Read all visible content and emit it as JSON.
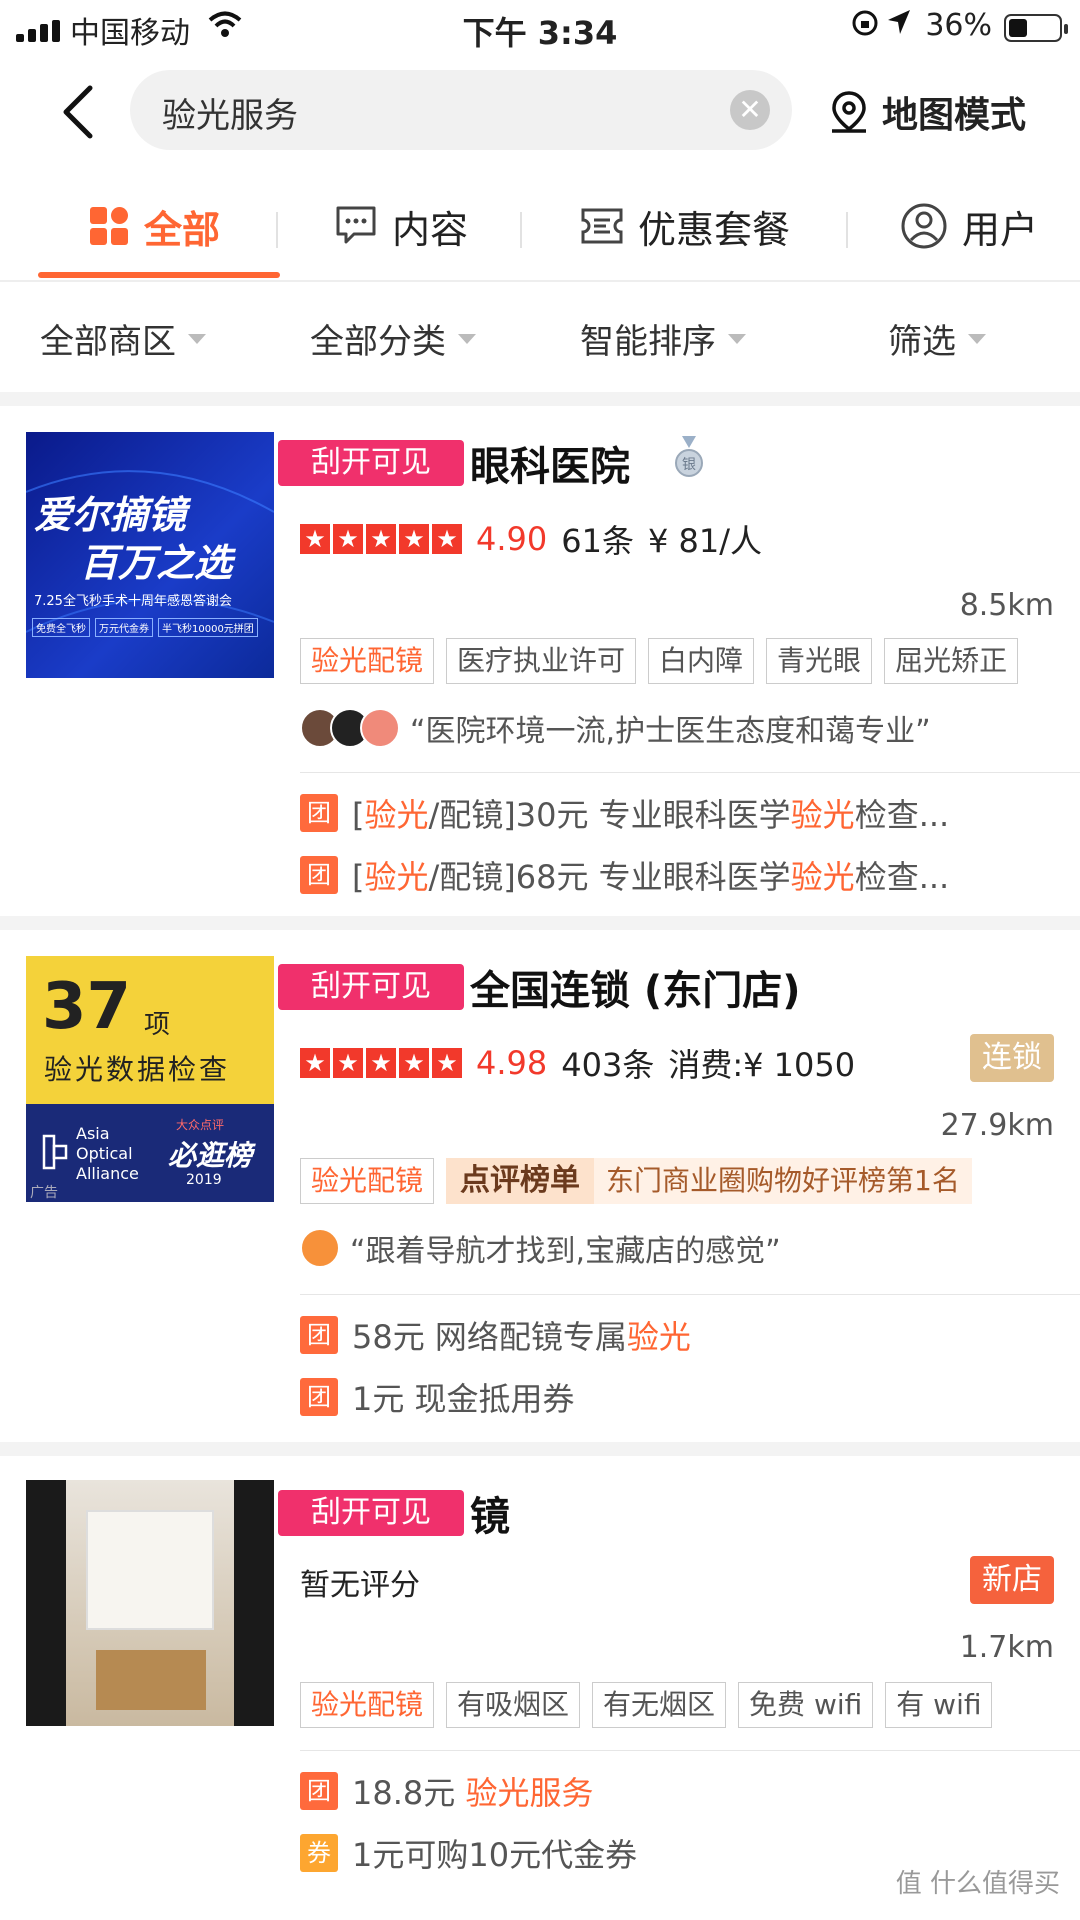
{
  "status_bar": {
    "carrier": "中国移动",
    "time": "下午 3:34",
    "battery": "36%"
  },
  "search": {
    "query": "验光服务",
    "map_mode": "地图模式"
  },
  "tabs": [
    {
      "label": "全部",
      "icon": "grid-icon"
    },
    {
      "label": "内容",
      "icon": "chat-icon"
    },
    {
      "label": "优惠套餐",
      "icon": "ticket-icon"
    },
    {
      "label": "用户",
      "icon": "user-icon"
    }
  ],
  "filters": [
    "全部商区",
    "全部分类",
    "智能排序",
    "筛选"
  ],
  "listings": [
    {
      "badge": "刮开可见",
      "name": "眼科医院",
      "medal": "银",
      "score": "4.90",
      "reviews": "61条",
      "price": "¥ 81/人",
      "distance": "8.5km",
      "thumb": {
        "line1": "爱尔摘镜",
        "line2": "百万之选",
        "line3": "7.25全飞秒手术十周年感恩答谢会",
        "chips": [
          "免费全飞秒",
          "万元代金券",
          "半飞秒10000元拼团"
        ]
      },
      "tags": [
        "验光配镜",
        "医疗执业许可",
        "白内障",
        "青光眼",
        "屈光矫正"
      ],
      "review": "“医院环境一流,护士医生态度和蔼专业”",
      "deals": [
        {
          "icon": "团",
          "pre": "[",
          "hl1": "验光",
          "mid": "/配镜]30元 专业眼科医学",
          "hl2": "验光",
          "post": "检查..."
        },
        {
          "icon": "团",
          "pre": "[",
          "hl1": "验光",
          "mid": "/配镜]68元 专业眼科医学",
          "hl2": "验光",
          "post": "检查..."
        }
      ]
    },
    {
      "badge": "刮开可见",
      "name": "全国连锁 (东门店)",
      "score": "4.98",
      "reviews": "403条",
      "price": "消费:¥ 1050",
      "pill": "连锁",
      "distance": "27.9km",
      "thumb": {
        "num": "37",
        "unit": "项",
        "title": "验光数据检查",
        "brand1": "Asia",
        "brand2": "Optical",
        "brand3": "Alliance",
        "award_top": "大众点评",
        "award": "必逛榜",
        "year": "2019",
        "ad": "广告"
      },
      "tags": [
        "验光配镜"
      ],
      "rank_left": "点评榜单",
      "rank_right": "东门商业圈购物好评榜第1名",
      "review": "“跟着导航才找到,宝藏店的感觉”",
      "deals": [
        {
          "icon": "团",
          "pre": "58元 网络配镜专属",
          "hl1": "验光"
        },
        {
          "icon": "团",
          "pre": "1元 现金抵用券"
        }
      ]
    },
    {
      "badge": "刮开可见",
      "name": "镜",
      "no_rating": "暂无评分",
      "pill": "新店",
      "distance": "1.7km",
      "tags": [
        "验光配镜",
        "有吸烟区",
        "有无烟区",
        "免费 wifi",
        "有 wifi"
      ],
      "deals": [
        {
          "icon": "团",
          "pre": "18.8元 ",
          "hl1": "验光服务"
        },
        {
          "icon": "券",
          "pre": "1元可购10元代金券"
        }
      ]
    }
  ],
  "watermark": "值 什么值得买",
  "colors": {
    "accent": "#ff6633",
    "badge": "#f0306c",
    "star": "#f2392b",
    "chain": "#e0c08f",
    "new": "#f5623d"
  }
}
